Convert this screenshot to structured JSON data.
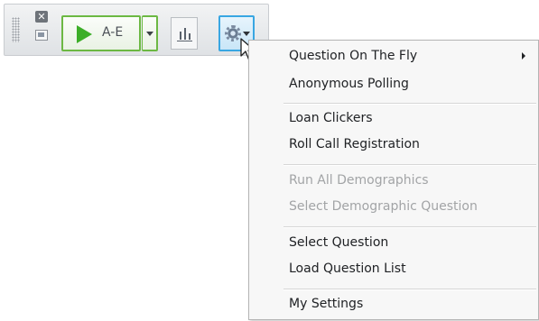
{
  "toolbar": {
    "close_icon": "close-icon",
    "minimize_icon": "window-icon",
    "start_button": {
      "label": "A-E",
      "icon": "play-icon",
      "accent": "#6cb843"
    },
    "start_dropdown_icon": "chevron-down-icon",
    "results_icon": "bar-chart-icon",
    "tools_button": {
      "icon": "gear-icon",
      "accent": "#39a6e2"
    }
  },
  "menu": {
    "items": [
      {
        "label": "Question On The Fly",
        "has_submenu": true,
        "enabled": true
      },
      {
        "label": "Anonymous Polling",
        "enabled": true
      },
      {
        "label": "Loan Clickers",
        "enabled": true
      },
      {
        "label": "Roll Call Registration",
        "enabled": true
      },
      {
        "label": "Run All Demographics",
        "enabled": false
      },
      {
        "label": "Select Demographic Question",
        "enabled": false
      },
      {
        "label": "Select Question",
        "enabled": true
      },
      {
        "label": "Load Question List",
        "enabled": true
      },
      {
        "label": "My Settings",
        "enabled": true
      }
    ]
  }
}
